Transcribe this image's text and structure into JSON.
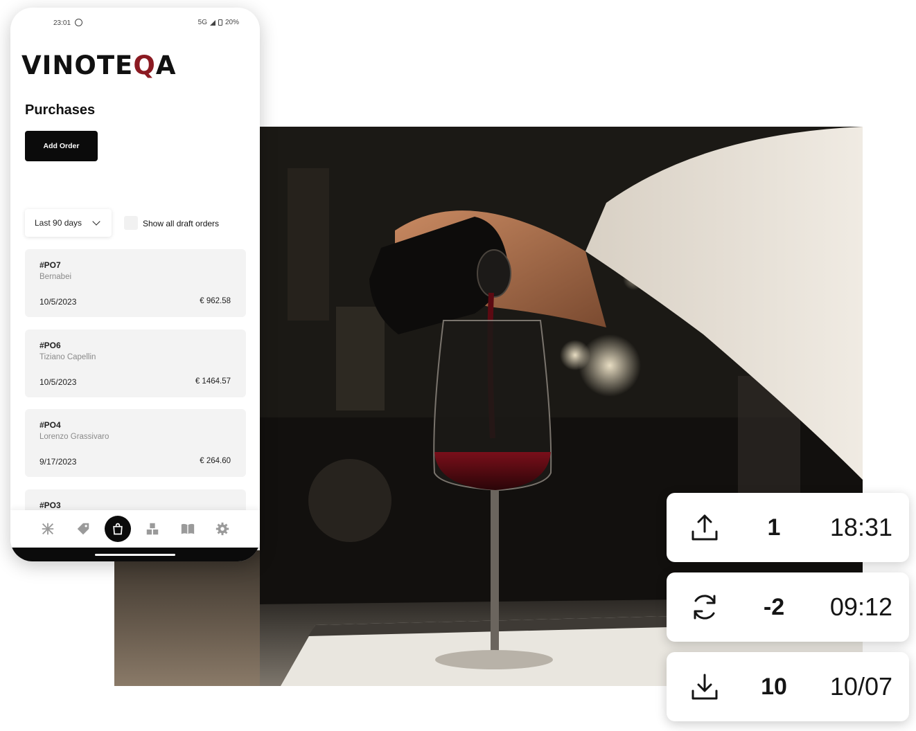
{
  "phone": {
    "status_bar": {
      "time": "23:01",
      "network": "5G",
      "battery": "20%"
    },
    "brand": {
      "prefix": "VINOTE",
      "highlight": "Q",
      "suffix": "A",
      "accent": "#8b1a22"
    },
    "page_title": "Purchases",
    "add_order_label": "Add Order",
    "filter": {
      "selected": "Last 90 days"
    },
    "draft_toggle": {
      "label": "Show all draft orders",
      "checked": false
    },
    "orders": [
      {
        "id": "#PO7",
        "supplier": "Bernabei",
        "date": "10/5/2023",
        "amount": "€ 962.58"
      },
      {
        "id": "#PO6",
        "supplier": "Tiziano Capellin",
        "date": "10/5/2023",
        "amount": "€ 1464.57"
      },
      {
        "id": "#PO4",
        "supplier": "Lorenzo Grassivaro",
        "date": "9/17/2023",
        "amount": "€ 264.60"
      },
      {
        "id": "#PO3",
        "supplier": "",
        "date": "",
        "amount": ""
      }
    ],
    "tabs": [
      "dashboard-icon",
      "tag-icon",
      "shopping-bag-icon",
      "boxes-icon",
      "book-icon",
      "gear-icon"
    ],
    "active_tab": "shopping-bag-icon"
  },
  "stats": [
    {
      "icon": "upload-icon",
      "value": "1",
      "time": "18:31"
    },
    {
      "icon": "sync-icon",
      "value": "-2",
      "time": "09:12"
    },
    {
      "icon": "download-icon",
      "value": "10",
      "time": "10/07"
    }
  ]
}
